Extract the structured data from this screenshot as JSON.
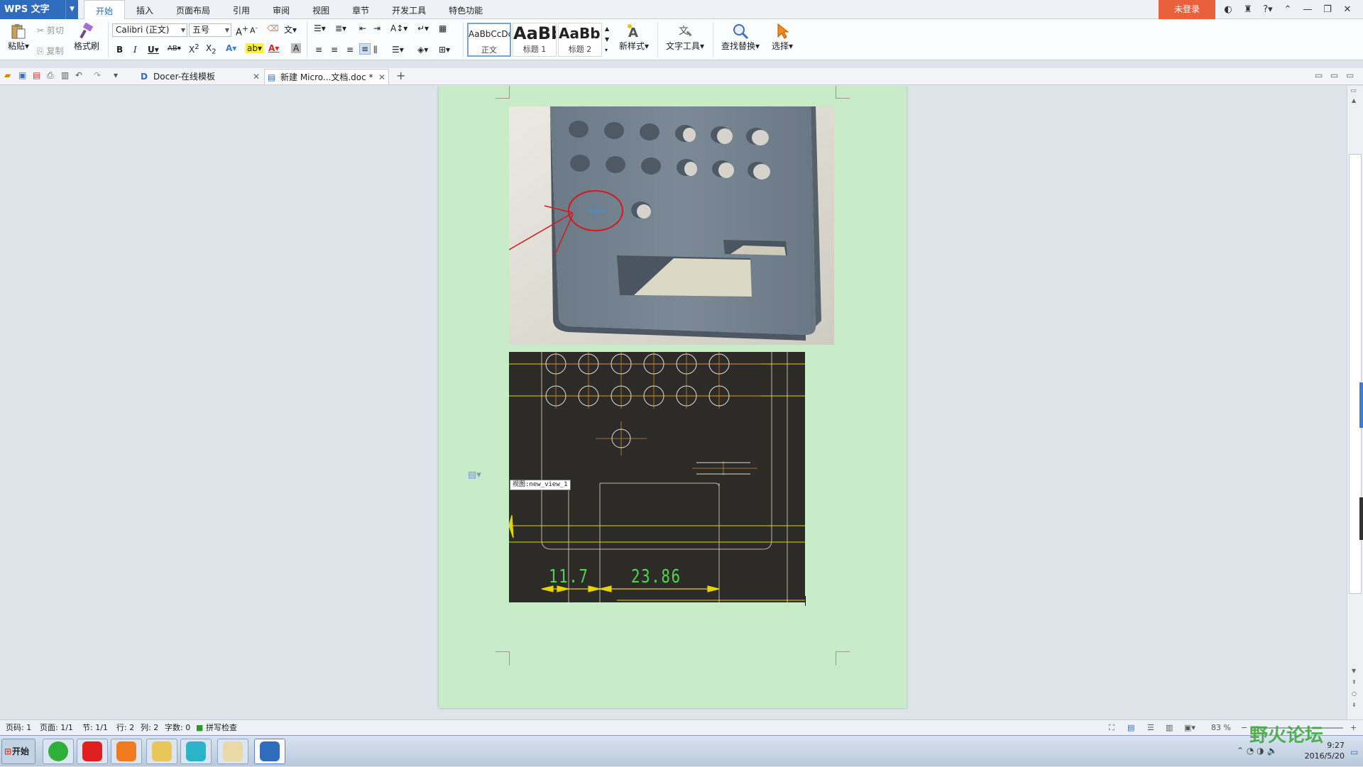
{
  "app": {
    "name": "WPS 文字",
    "login": "未登录"
  },
  "menu_tabs": [
    "开始",
    "插入",
    "页面布局",
    "引用",
    "审阅",
    "视图",
    "章节",
    "开发工具",
    "特色功能"
  ],
  "ribbon": {
    "paste": "粘贴",
    "cut": "剪切",
    "copy": "复制",
    "format_painter": "格式刷",
    "font_name": "Calibri (正文)",
    "font_size": "五号",
    "styles": [
      {
        "preview": "AaBbCcDd",
        "label": "正文"
      },
      {
        "preview": "AaBb",
        "label": "标题 1"
      },
      {
        "preview": "AaBb(",
        "label": "标题 2"
      }
    ],
    "new_style": "新样式",
    "text_tools": "文字工具",
    "find_replace": "查找替换",
    "select": "选择"
  },
  "doc_tabs": [
    {
      "label": "Docer-在线模板"
    },
    {
      "label": "新建 Micro...文档.doc *"
    }
  ],
  "document": {
    "cad_view_label": "视图:new_view_1",
    "dim1": "11.7",
    "dim2": "23.86"
  },
  "status": {
    "page_num": "页码: 1",
    "pages": "页面: 1/1",
    "section": "节: 1/1",
    "line": "行: 2",
    "col": "列: 2",
    "words": "字数: 0",
    "spell": "拼写检查",
    "zoom": "83 %"
  },
  "taskbar": {
    "start": "开始",
    "time": "9:27",
    "date": "2016/5/20"
  },
  "watermark": "野火论坛",
  "colors": {
    "accent": "#2f6cbd",
    "login_bg": "#e8613c",
    "page_bg": "#c8ebc8",
    "cad_bg": "#2c2b27",
    "cad_yellow": "#e6d400",
    "cad_green": "#4fd64f"
  }
}
